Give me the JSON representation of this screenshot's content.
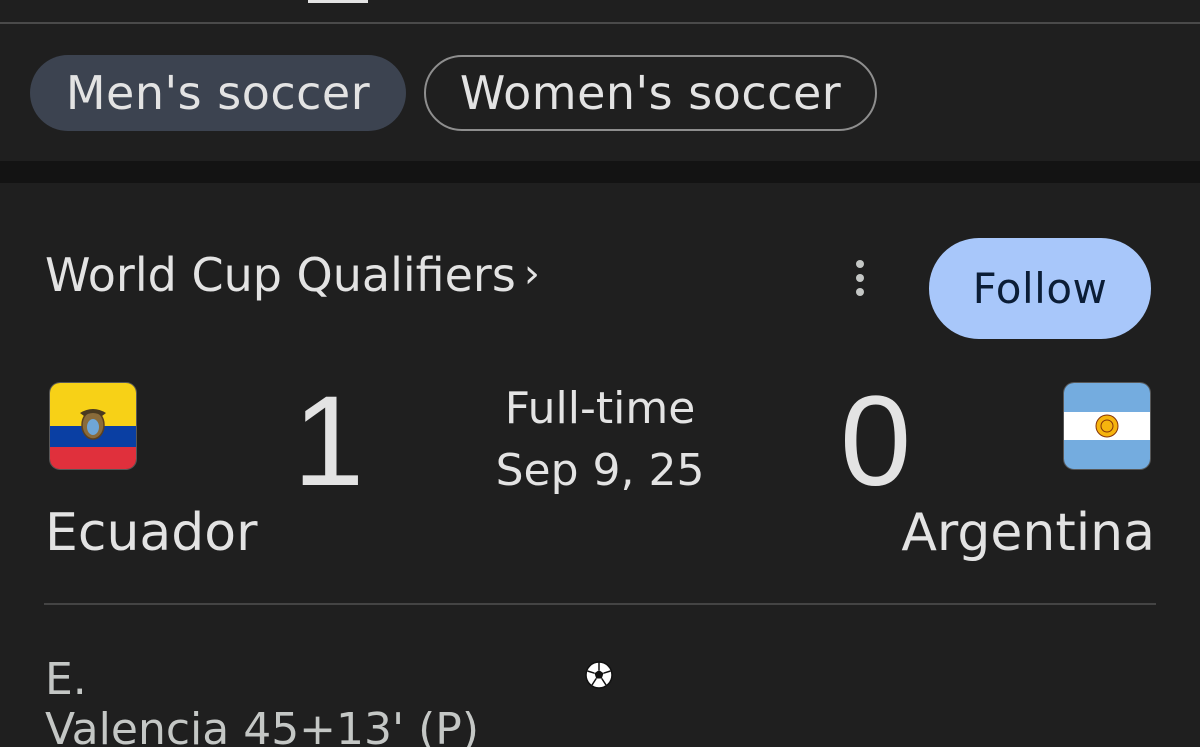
{
  "filter_chips": [
    {
      "label": "Men's soccer",
      "selected": true
    },
    {
      "label": "Women's soccer",
      "selected": false
    }
  ],
  "match_card": {
    "league": "World Cup Qualifiers",
    "league_chevron": "›",
    "more_icon": "more-vert-icon",
    "follow_label": "Follow",
    "status": "Full-time",
    "date": "Sep 9, 25",
    "home": {
      "name": "Ecuador",
      "score": "1",
      "flag": "ecuador-flag"
    },
    "away": {
      "name": "Argentina",
      "score": "0",
      "flag": "argentina-flag"
    },
    "goal_events": [
      {
        "scorer_line1": "E.",
        "scorer_line2": "Valencia 45+13' (P)",
        "icon": "soccer-ball-icon"
      }
    ]
  },
  "colors": {
    "background": "#1f1f1f",
    "chip_selected": "#3c4350",
    "follow_button": "#a8c7fa"
  }
}
